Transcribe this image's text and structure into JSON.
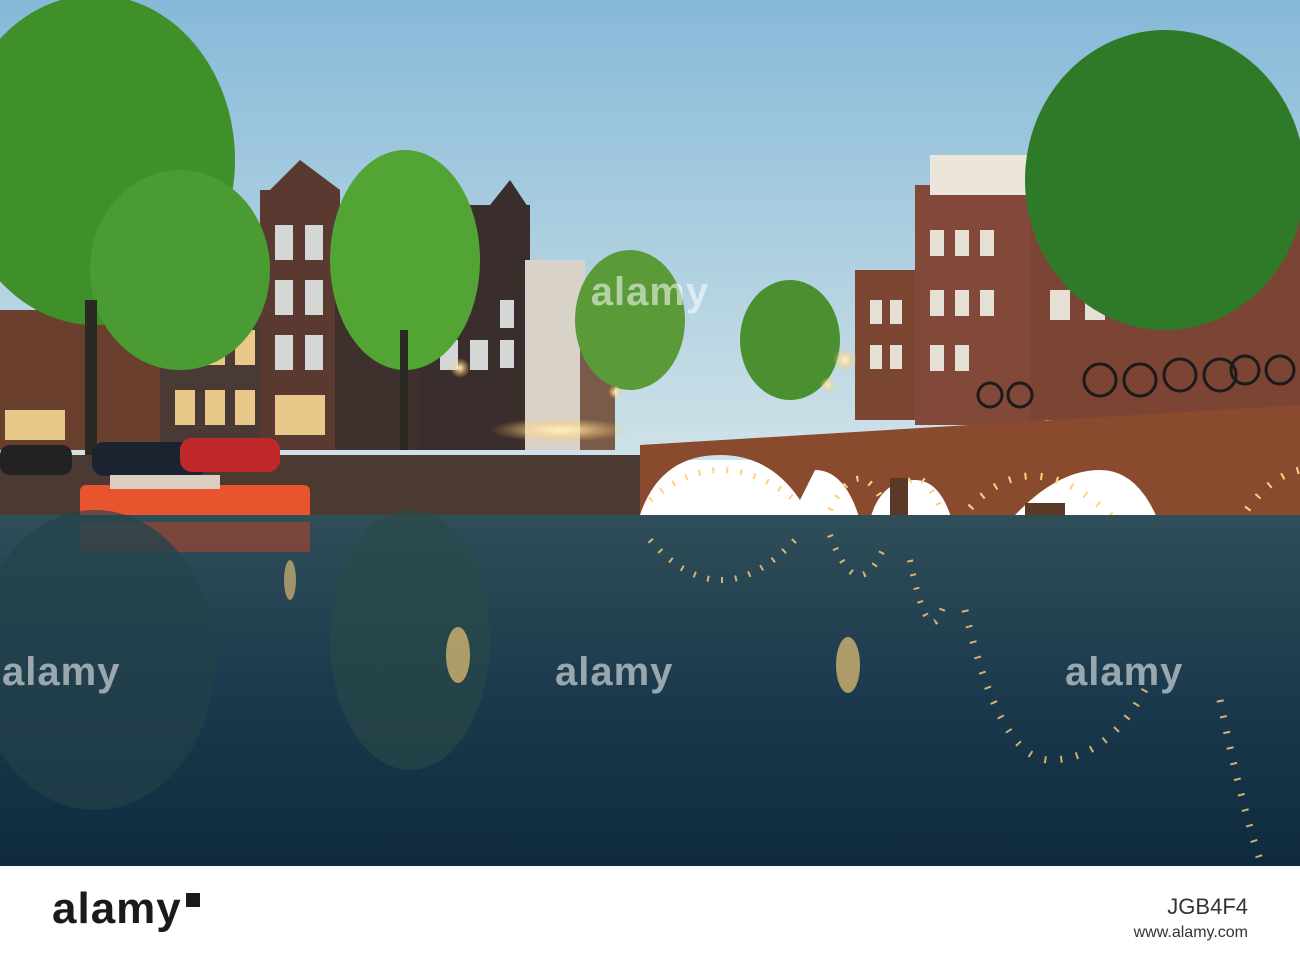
{
  "watermark": {
    "center_text": "alamy",
    "row_left_text": "alamy",
    "row_mid_text": "alamy",
    "row_right_text": "alamy",
    "top_repeat": "a"
  },
  "footer": {
    "brand": "alamy",
    "image_id": "JGB4F4",
    "url": "www.alamy.com"
  },
  "colors": {
    "sky_top": "#8fc0dc",
    "sky_bottom": "#c9e0ea",
    "water": "#1c3b4e",
    "bridge_brick": "#8a4a2e",
    "light": "#ffd27a",
    "boat": "#e8542d",
    "tree": "#3f8f2a"
  }
}
